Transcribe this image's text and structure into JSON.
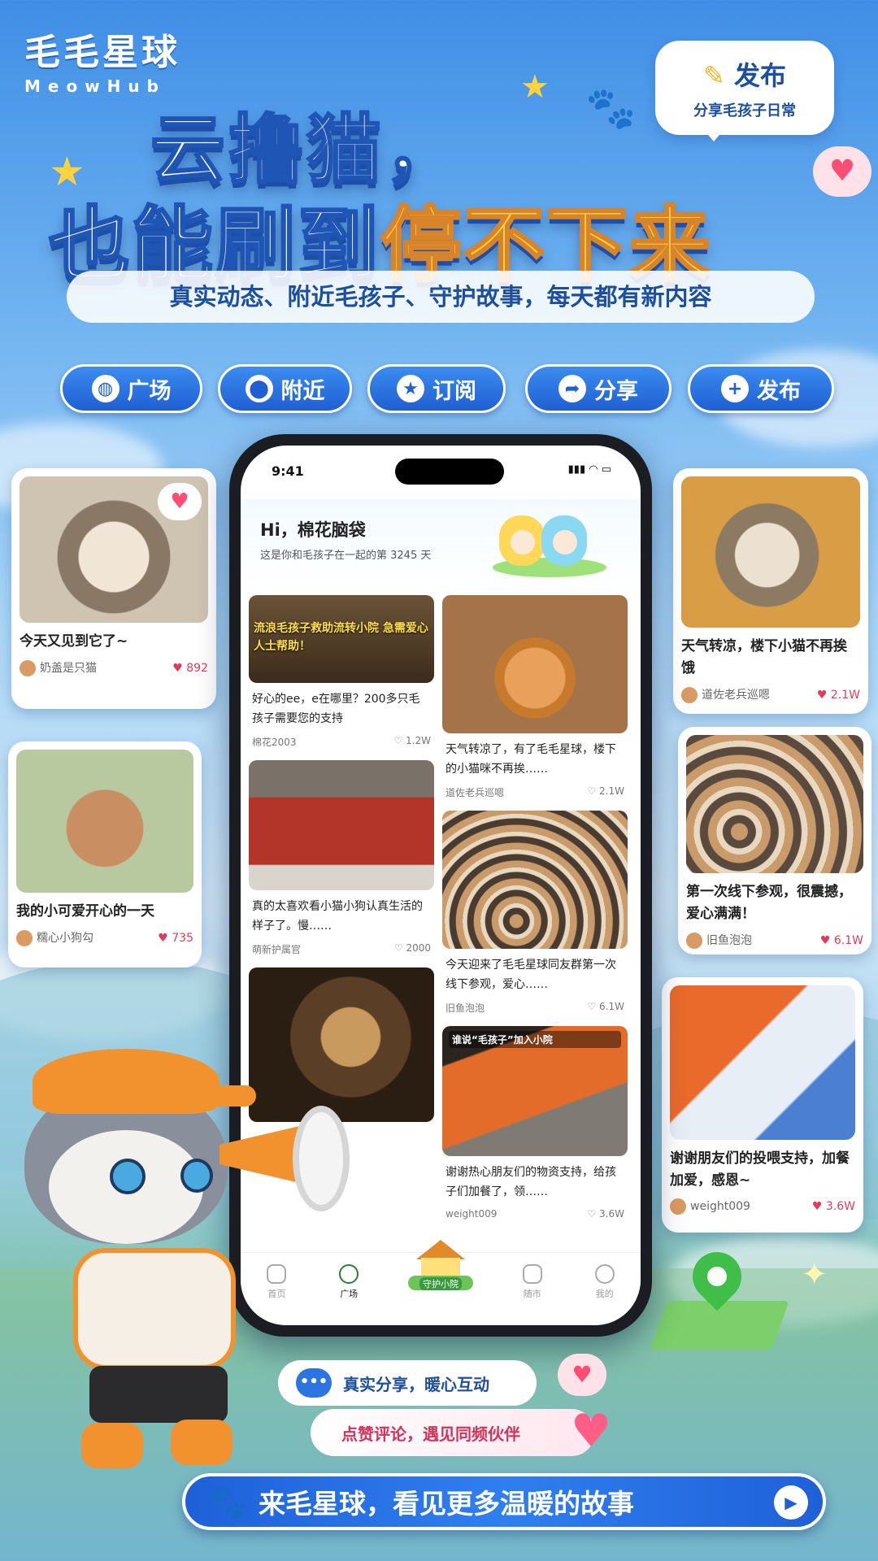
{
  "brand": {
    "name_cn": "毛毛星球",
    "name_en": "MeowHub"
  },
  "publish_bubble": {
    "title": "发布",
    "subtitle": "分享毛孩子日常"
  },
  "headline": {
    "line1": "云撸猫，",
    "line2_plain": "也能刷到",
    "line2_highlight": "停不下来"
  },
  "subtitle": "真实动态、附近毛孩子、守护故事，每天都有新内容",
  "nav_pills": [
    {
      "label": "广场",
      "icon": "planet-icon"
    },
    {
      "label": "附近",
      "icon": "location-pin-icon"
    },
    {
      "label": "订阅",
      "icon": "star-icon"
    },
    {
      "label": "分享",
      "icon": "share-arrow-icon"
    },
    {
      "label": "发布",
      "icon": "plus-icon"
    }
  ],
  "left_cards": [
    {
      "caption": "今天又见到它了~",
      "user": "奶盖是只猫",
      "likes": "892"
    },
    {
      "caption": "我的小可爱开心的一天",
      "user": "糯心小狗勾",
      "likes": "735"
    }
  ],
  "right_cards": [
    {
      "caption": "天气转凉，楼下小猫不再挨饿",
      "user": "道佐老兵巡嗯",
      "likes": "2.1W"
    },
    {
      "caption": "第一次线下参观，很震撼，爱心满满！",
      "user": "旧鱼泡泡",
      "likes": "6.1W"
    },
    {
      "caption": "谢谢朋友们的投喂支持，加餐加爱，感恩~",
      "user": "weight009",
      "likes": "3.6W"
    }
  ],
  "phone": {
    "time": "9:41",
    "greeting": "Hi，棉花脑袋",
    "days_text": "这是你和毛孩子在一起的第 3245 天",
    "feed_left": [
      {
        "banner": "流浪毛孩子救助流转小院 急需爱心人士帮助！",
        "caption": "好心的ee，e在哪里？200多只毛孩子需要您的支持",
        "user": "棉花2003",
        "likes": "1.2W"
      },
      {
        "caption": "真的太喜欢看小猫小狗认真生活的样子了。慢……",
        "user": "萌新护属官",
        "likes": "2000"
      },
      {
        "caption": "",
        "user": "",
        "likes": ""
      }
    ],
    "feed_right": [
      {
        "caption": "天气转凉了，有了毛毛星球，楼下的小猫咪不再挨……",
        "user": "道佐老兵巡嗯",
        "likes": "2.1W"
      },
      {
        "caption": "今天迎来了毛毛星球同友群第一次线下参观，爱心……",
        "user": "旧鱼泡泡",
        "likes": "6.1W"
      },
      {
        "banner": "谁说“毛孩子”加入小院",
        "caption": "谢谢热心朋友们的物资支持，给孩子们加餐了，领……",
        "user": "weight009",
        "likes": "3.6W"
      }
    ],
    "tabs": [
      {
        "label": "首页"
      },
      {
        "label": "广场"
      },
      {
        "label": "守护小院"
      },
      {
        "label": "随市"
      },
      {
        "label": "我的"
      }
    ]
  },
  "bubble_share": "真实分享，暖心互动",
  "bubble_like": "点赞评论，遇见同频伙伴",
  "cta": "来毛星球，看见更多温暖的故事",
  "colors": {
    "accent_blue": "#1f60d8",
    "highlight_yellow": "#ffd23f",
    "like_red": "#e23b5a"
  }
}
